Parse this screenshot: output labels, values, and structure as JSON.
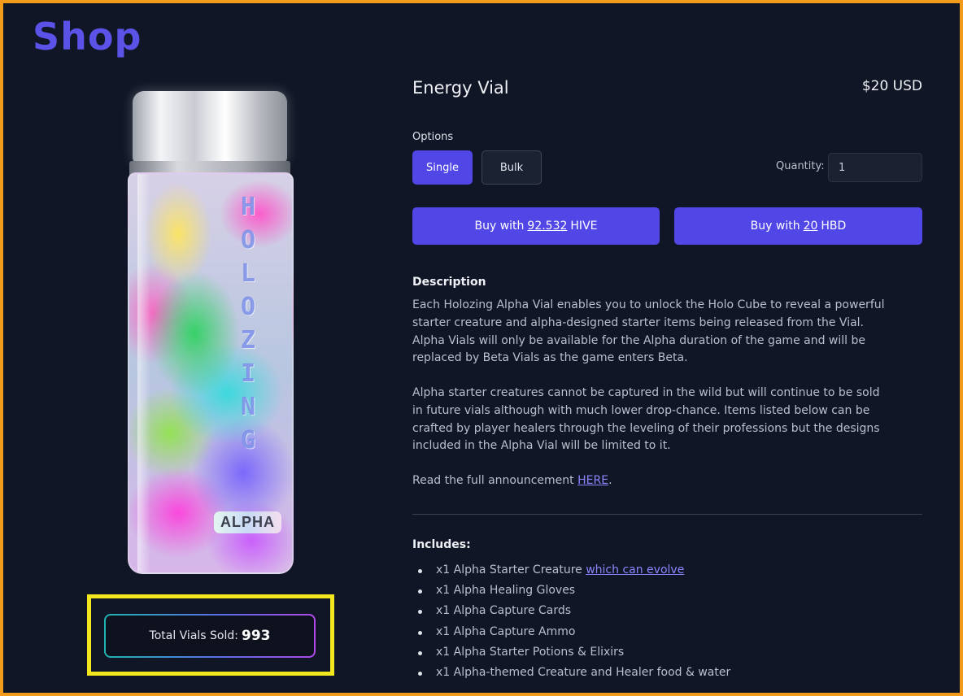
{
  "page": {
    "title": "Shop"
  },
  "vial": {
    "letters": [
      "H",
      "O",
      "L",
      "O",
      "Z",
      "I",
      "N",
      "G"
    ],
    "badge": "ALPHA"
  },
  "sold": {
    "label": "Total Vials Sold:",
    "count": "993"
  },
  "product": {
    "name": "Energy Vial",
    "price": "$20 USD",
    "options_label": "Options",
    "options": [
      "Single",
      "Bulk"
    ],
    "selected_option": "Single",
    "quantity_label": "Quantity:",
    "quantity_value": "1"
  },
  "buy": {
    "hive": {
      "prefix": "Buy with",
      "amount": "92.532",
      "currency": "HIVE"
    },
    "hbd": {
      "prefix": "Buy with",
      "amount": "20",
      "currency": "HBD"
    }
  },
  "description": {
    "title": "Description",
    "para1": "Each Holozing Alpha Vial enables you to unlock the Holo Cube to reveal a powerful starter creature and alpha-designed starter items being released from the Vial. Alpha Vials will only be available for the Alpha duration of the game and will be replaced by Beta Vials as the game enters Beta.",
    "para2": "Alpha starter creatures cannot be captured in the wild but will continue to be sold in future vials although with much lower drop-chance. Items listed below can be crafted by player healers through the leveling of their professions but the designs included in the Alpha Vial will be limited to it.",
    "para3_prefix": "Read the full announcement",
    "para3_link": "HERE",
    "para3_suffix": "."
  },
  "includes": {
    "title": "Includes:",
    "items": [
      {
        "text": "x1 Alpha Starter Creature",
        "link": "which can evolve"
      },
      {
        "text": "x1 Alpha Healing Gloves"
      },
      {
        "text": "x1 Alpha Capture Cards"
      },
      {
        "text": "x1 Alpha Capture Ammo"
      },
      {
        "text": "x1 Alpha Starter Potions & Elixirs"
      },
      {
        "text": "x1 Alpha-themed Creature and Healer food & water"
      }
    ]
  },
  "colors": {
    "accent": "#5146e6",
    "background": "#111626",
    "frame": "#f29a1a",
    "highlight": "#f4e71e"
  }
}
